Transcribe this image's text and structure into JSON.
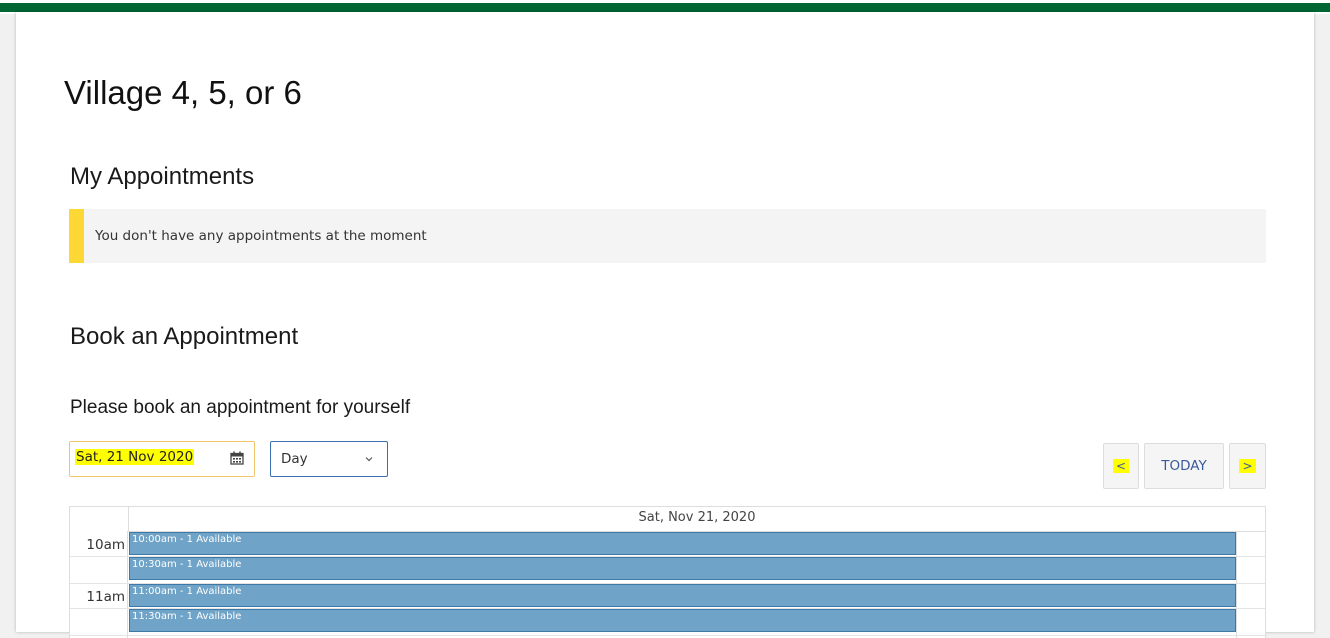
{
  "page": {
    "title": "Village 4, 5, or 6"
  },
  "my_appointments": {
    "heading": "My Appointments",
    "notice": "You don't have any appointments at the moment"
  },
  "booking": {
    "heading": "Book an Appointment",
    "subheading": "Please book an appointment for yourself",
    "date_value": "Sat, 21 Nov 2020",
    "view_select": "Day",
    "prev_label": "<",
    "today_label": "TODAY",
    "next_label": ">"
  },
  "calendar": {
    "day_header": "Sat, Nov 21, 2020",
    "hours": [
      "10am",
      "11am"
    ],
    "slots": [
      "10:00am - 1 Available",
      "10:30am - 1 Available",
      "11:00am - 1 Available",
      "11:30am - 1 Available"
    ]
  },
  "colors": {
    "accent_bar": "#006633",
    "notice_bar": "#fdd835",
    "slot_fill": "#6fa3c7",
    "highlight": "#ffff00"
  },
  "icons": [
    "calendar-icon",
    "chevron-down-icon"
  ]
}
